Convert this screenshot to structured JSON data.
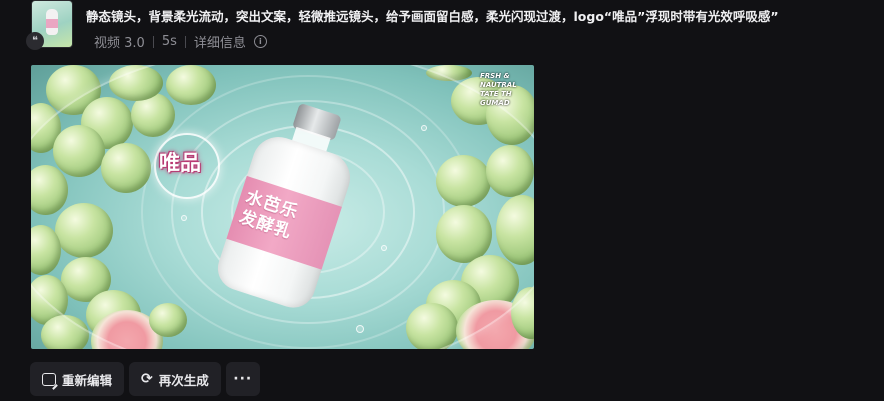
{
  "task": {
    "prompt": "静态镜头，背景柔光流动，突出文案，轻微推远镜头，给予画面留白感，柔光闪现过渡，logo“唯品”浮现时带有光效呼吸感”",
    "model": "视频 3.0",
    "duration": "5s",
    "details_label": "详细信息",
    "quote_icon": "quote-icon",
    "info_icon": "info-icon"
  },
  "video": {
    "logo_text": "唯品",
    "bottle_label": "水芭乐\n发酵乳",
    "corner_text_line1": "FRSH & NAUTRAL",
    "corner_text_line2": "TATE TH GUMAD"
  },
  "actions": {
    "edit_label": "重新编辑",
    "regenerate_label": "再次生成",
    "more_label": "···"
  },
  "colors": {
    "background": "#111114",
    "button_bg": "#212126",
    "label_pink": "#f2a9c6",
    "water": "#a9dcd6"
  }
}
